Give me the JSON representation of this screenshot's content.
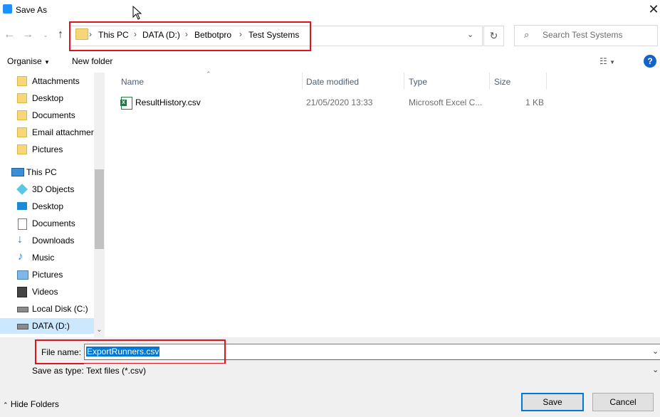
{
  "window": {
    "title": "Save As"
  },
  "address": {
    "segments": [
      "This PC",
      "DATA (D:)",
      "Betbotpro",
      "Test Systems"
    ]
  },
  "search": {
    "placeholder": "Search Test Systems"
  },
  "toolbar": {
    "organise": "Organise",
    "new_folder": "New folder"
  },
  "sidebar": {
    "quick_items": [
      {
        "label": "Attachments"
      },
      {
        "label": "Desktop"
      },
      {
        "label": "Documents"
      },
      {
        "label": "Email attachmer"
      },
      {
        "label": "Pictures"
      }
    ],
    "this_pc": {
      "label": "This PC"
    },
    "pc_items": [
      {
        "label": "3D Objects",
        "icon": "cube-icon"
      },
      {
        "label": "Desktop",
        "icon": "desktop-icon"
      },
      {
        "label": "Documents",
        "icon": "document-icon"
      },
      {
        "label": "Downloads",
        "icon": "download-icon"
      },
      {
        "label": "Music",
        "icon": "music-icon"
      },
      {
        "label": "Pictures",
        "icon": "picture-icon"
      },
      {
        "label": "Videos",
        "icon": "video-icon"
      },
      {
        "label": "Local Disk (C:)",
        "icon": "drive-icon"
      },
      {
        "label": "DATA (D:)",
        "icon": "drive-icon",
        "selected": true
      }
    ]
  },
  "columns": {
    "name": "Name",
    "date": "Date modified",
    "type": "Type",
    "size": "Size"
  },
  "files": [
    {
      "name": "ResultHistory.csv",
      "date": "21/05/2020 13:33",
      "type": "Microsoft Excel C...",
      "size": "1 KB"
    }
  ],
  "form": {
    "filename_label": "File name:",
    "filename_value": "ExportRunners.csv",
    "savetype_label": "Save as type:",
    "savetype_value": "Text files (*.csv)"
  },
  "buttons": {
    "hide_folders": "Hide Folders",
    "save": "Save",
    "cancel": "Cancel"
  },
  "colors": {
    "accent": "#0078d7",
    "highlight": "#e0141e",
    "selection": "#cce8ff"
  }
}
